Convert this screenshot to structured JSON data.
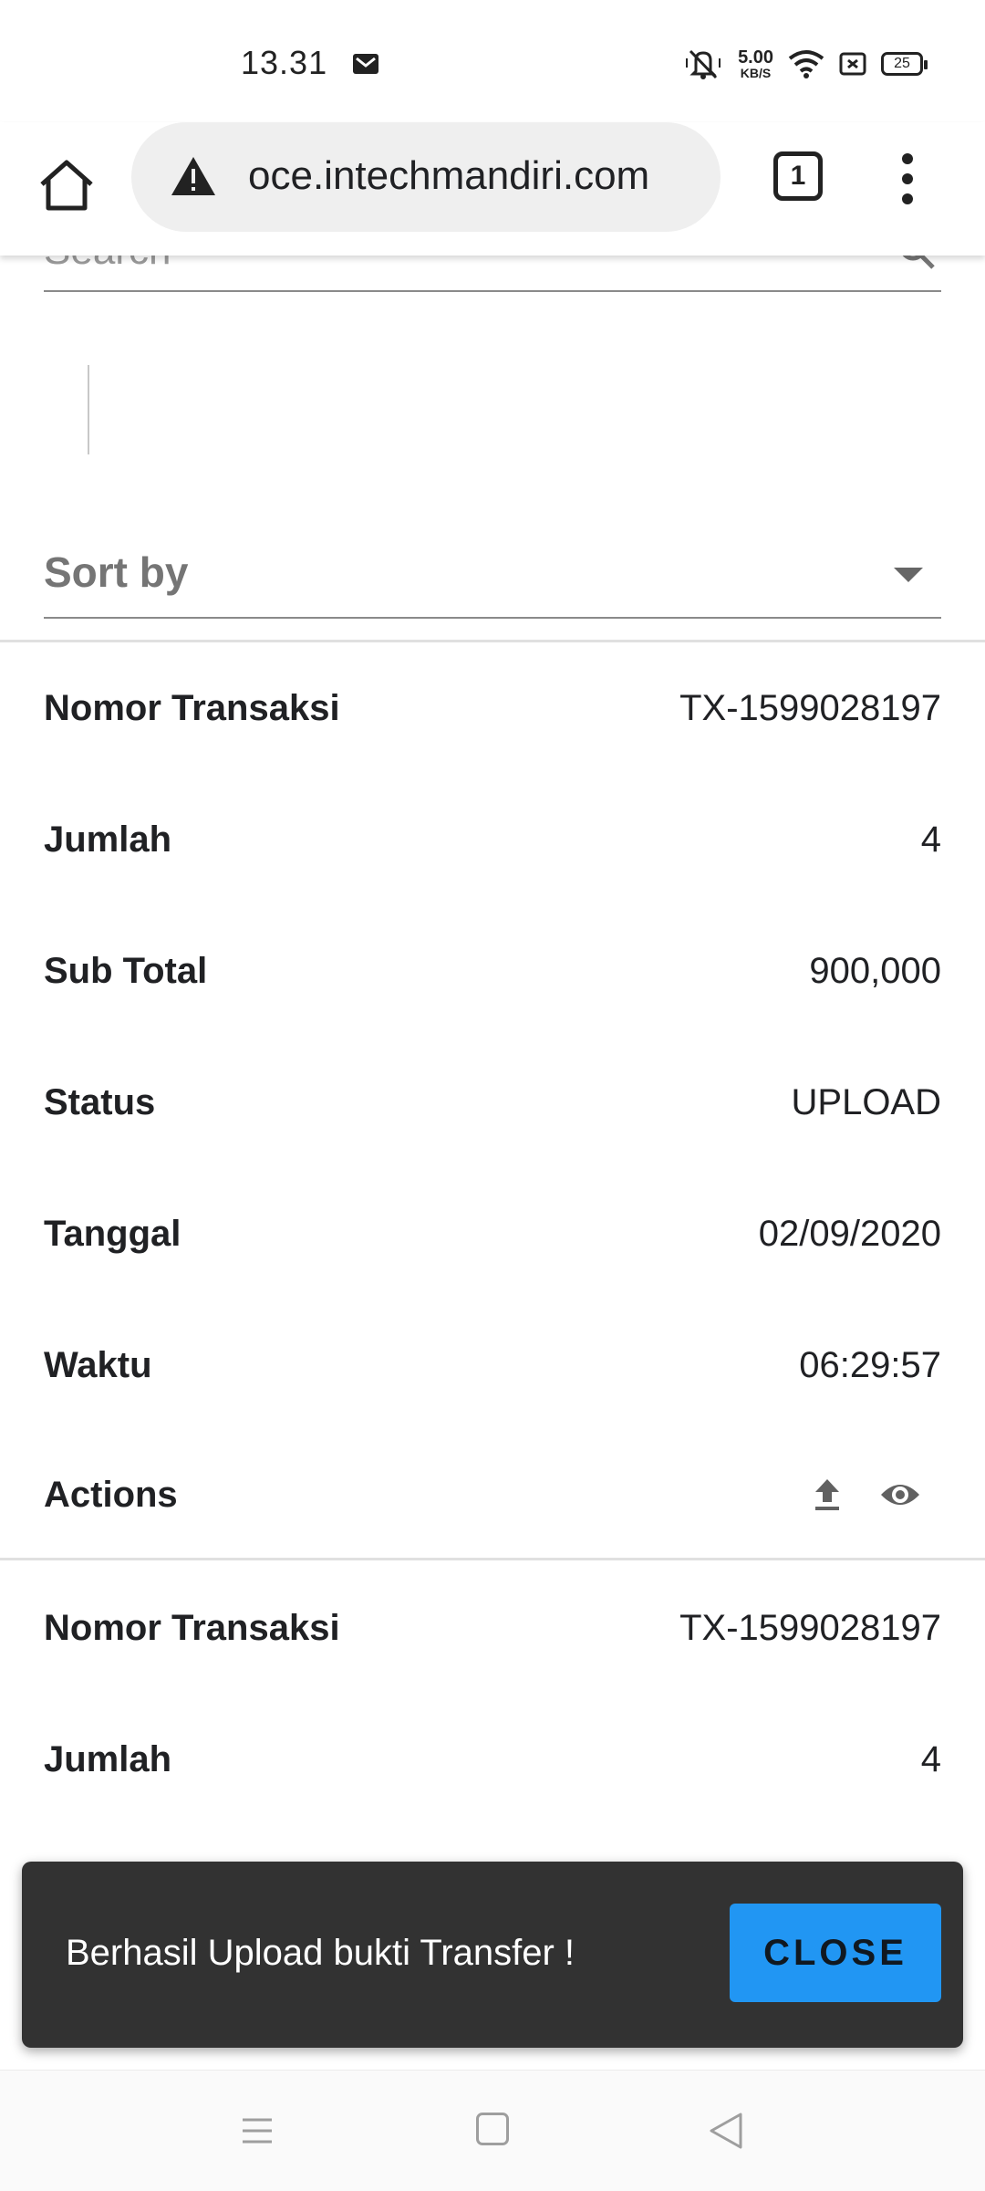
{
  "status_bar": {
    "time": "13.31",
    "net_speed_value": "5.00",
    "net_speed_unit": "KB/S",
    "battery": "25"
  },
  "browser": {
    "url": "oce.intechmandiri.com",
    "tab_count": "1"
  },
  "search": {
    "placeholder": "Search"
  },
  "sort": {
    "label": "Sort by"
  },
  "records": [
    {
      "nomor_transaksi": {
        "label": "Nomor Transaksi",
        "value": "TX-1599028197"
      },
      "jumlah": {
        "label": "Jumlah",
        "value": "4"
      },
      "sub_total": {
        "label": "Sub Total",
        "value": "900,000"
      },
      "status": {
        "label": "Status",
        "value": "UPLOAD"
      },
      "tanggal": {
        "label": "Tanggal",
        "value": "02/09/2020"
      },
      "waktu": {
        "label": "Waktu",
        "value": "06:29:57"
      },
      "actions": {
        "label": "Actions"
      }
    },
    {
      "nomor_transaksi": {
        "label": "Nomor Transaksi",
        "value": "TX-1599028197"
      },
      "jumlah": {
        "label": "Jumlah",
        "value": "4"
      }
    }
  ],
  "snackbar": {
    "message": "Berhasil Upload bukti Transfer !",
    "close_label": "CLOSE"
  },
  "colors": {
    "snackbar_bg": "#323232",
    "close_button": "#2196f3"
  },
  "icons": [
    "mail-icon",
    "mute-icon",
    "wifi-icon",
    "sim-icon",
    "home-icon",
    "warning-icon",
    "tabs-icon",
    "more-vert-icon",
    "search-icon",
    "chevron-down-icon",
    "upload-icon",
    "eye-icon",
    "nav-menu-icon",
    "nav-home-icon",
    "nav-back-icon"
  ]
}
